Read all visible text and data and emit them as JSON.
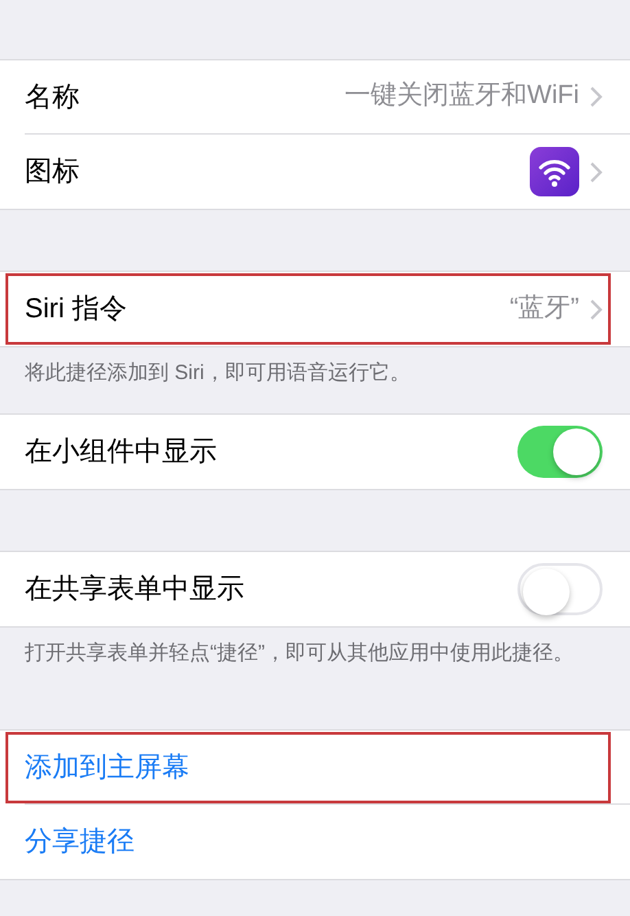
{
  "sections": [
    {
      "rows": [
        {
          "kind": "value",
          "label": "名称",
          "value": "一键关闭蓝牙和WiFi",
          "highlighted": false
        },
        {
          "kind": "icon",
          "label": "图标",
          "highlighted": false
        }
      ]
    },
    {
      "rows": [
        {
          "kind": "value",
          "label": "Siri 指令",
          "value": "“蓝牙”",
          "highlighted": true
        }
      ],
      "footer": "将此捷径添加到 Siri，即可用语音运行它。"
    },
    {
      "rows": [
        {
          "kind": "toggle",
          "label": "在小组件中显示",
          "on": true,
          "highlighted": false
        }
      ]
    },
    {
      "rows": [
        {
          "kind": "toggle",
          "label": "在共享表单中显示",
          "on": false,
          "highlighted": false
        }
      ],
      "footer": "打开共享表单并轻点“捷径”，即可从其他应用中使用此捷径。"
    },
    {
      "rows": [
        {
          "kind": "action",
          "label": "添加到主屏幕",
          "highlighted": true
        },
        {
          "kind": "action",
          "label": "分享捷径",
          "highlighted": false
        }
      ]
    }
  ]
}
